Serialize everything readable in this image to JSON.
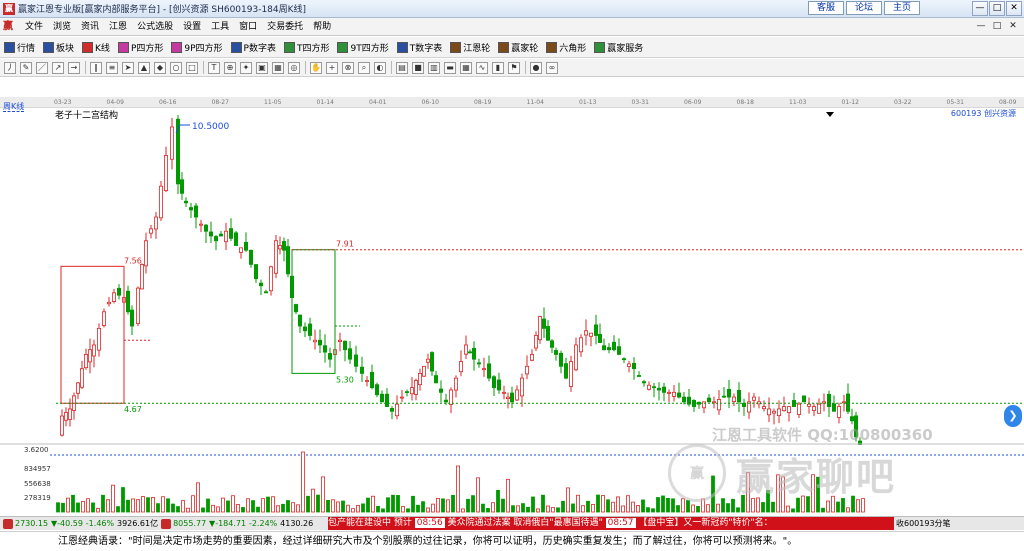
{
  "window": {
    "app_icon": "赢",
    "title": "赢家江恩专业版[赢家内部服务平台] - [创兴资源  SH600193-184周K线]",
    "links": [
      "客服",
      "论坛",
      "主页"
    ],
    "controls": [
      "—",
      "□",
      "✕"
    ]
  },
  "menubar": {
    "logo": "赢",
    "items": [
      "文件",
      "浏览",
      "资讯",
      "江恩",
      "公式选股",
      "设置",
      "工具",
      "窗口",
      "交易委托",
      "帮助"
    ],
    "window_controls": [
      "—",
      "□",
      "✕"
    ]
  },
  "toolbar_main": {
    "buttons": [
      {
        "label": "行情",
        "icon": "grid-icon",
        "color": "#2a4fa0"
      },
      {
        "label": "板块",
        "icon": "blocks-icon",
        "color": "#2a4fa0"
      },
      {
        "label": "K线",
        "icon": "candles-icon",
        "color": "#d22b2b"
      },
      {
        "label": "P四方形",
        "icon": "square-p-icon",
        "color": "#c43a9e"
      },
      {
        "label": "9P四方形",
        "icon": "square-9p-icon",
        "color": "#c43a9e"
      },
      {
        "label": "P数字表",
        "icon": "table-p-icon",
        "color": "#2a4fa0"
      },
      {
        "label": "T四方形",
        "icon": "square-t-icon",
        "color": "#2f8f3a"
      },
      {
        "label": "9T四方形",
        "icon": "square-9t-icon",
        "color": "#2f8f3a"
      },
      {
        "label": "T数字表",
        "icon": "table-t-icon",
        "color": "#2a4fa0"
      },
      {
        "label": "江恩轮",
        "icon": "wheel-icon",
        "color": "#7a4a1a"
      },
      {
        "label": "赢家轮",
        "icon": "wheel2-icon",
        "color": "#7a4a1a"
      },
      {
        "label": "六角形",
        "icon": "hexagon-icon",
        "color": "#7a4a1a"
      },
      {
        "label": "赢家服务",
        "icon": "dollar-icon",
        "color": "#2f8f3a"
      }
    ]
  },
  "toolbar_tools": {
    "icons": [
      "cursor-icon",
      "draw-icon",
      "line-icon",
      "trend-icon",
      "ray-icon",
      "channel-icon",
      "fib-icon",
      "arrow-icon",
      "tri-icon",
      "diamond-icon",
      "circle-icon",
      "rect-icon",
      "text-icon",
      "gann-icon",
      "fan-icon",
      "box-icon",
      "square-icon",
      "cycle-icon",
      "hand-icon",
      "cross-icon",
      "magnet-icon",
      "zoom-icon",
      "palette-icon",
      "grid-icon",
      "save-icon",
      "print-icon",
      "monitor-icon",
      "calc-icon",
      "wave-icon",
      "bars-icon",
      "flag-icon",
      "color-icon",
      "link-icon"
    ]
  },
  "chart": {
    "period_label": "周K线",
    "indicator_name": "老子十二宫结构",
    "stock_label": "600193 创兴资源",
    "date_ticks": [
      "03-23",
      "04-09",
      "06-16",
      "08-27",
      "11-05",
      "01-14",
      "04-01",
      "06-10",
      "08-19",
      "11-04",
      "01-13",
      "03-31",
      "06-09",
      "08-18",
      "11-03",
      "01-12",
      "03-22",
      "05-31",
      "08-09"
    ],
    "annotations": {
      "high": "10.5000",
      "low": "3.6200",
      "level_791": "7.91",
      "level_756": "7.56",
      "level_530": "5.30",
      "level_467": "4.67"
    },
    "colors": {
      "up": "#e02424",
      "down": "#009a00",
      "level_up": "#e02424",
      "level_dn": "#009a00",
      "annot": "#1d4ed8"
    }
  },
  "volume": {
    "axis_labels": [
      "3.6200",
      "834957",
      "556638",
      "278319"
    ]
  },
  "watermark": {
    "top_text": "江恩工具软件  QQ:100800360",
    "circle_text": "赢",
    "main_text": "赢家聊吧"
  },
  "statusbar": {
    "sh_index": "2730.15",
    "sh_change": "▼-40.59",
    "sh_pct": "-1.46%",
    "sh_amount": "3926.61亿",
    "sz_index": "8055.77",
    "sz_change": "▼-184.71",
    "sz_pct": "-2.24%",
    "sz_amount": "4130.26",
    "ticker_segments": [
      {
        "type": "text",
        "value": "包产能在建设中 预计"
      },
      {
        "type": "time",
        "value": "08:56"
      },
      {
        "type": "text",
        "value": "美众院通过法案 取消俄白\"最惠国待遇\""
      },
      {
        "type": "time",
        "value": "08:57"
      },
      {
        "type": "text",
        "value": "【盘中宝】又一新冠药\"特价\"名："
      }
    ],
    "right_text": "收600193分笔"
  },
  "quote": {
    "text": "江恩经典语录：\"时间是决定市场走势的重要因素，经过详细研究大市及个别股票的过往记录，你将可以证明，历史确实重复发生；而了解过往，你将可以预测将来。\"。"
  }
}
